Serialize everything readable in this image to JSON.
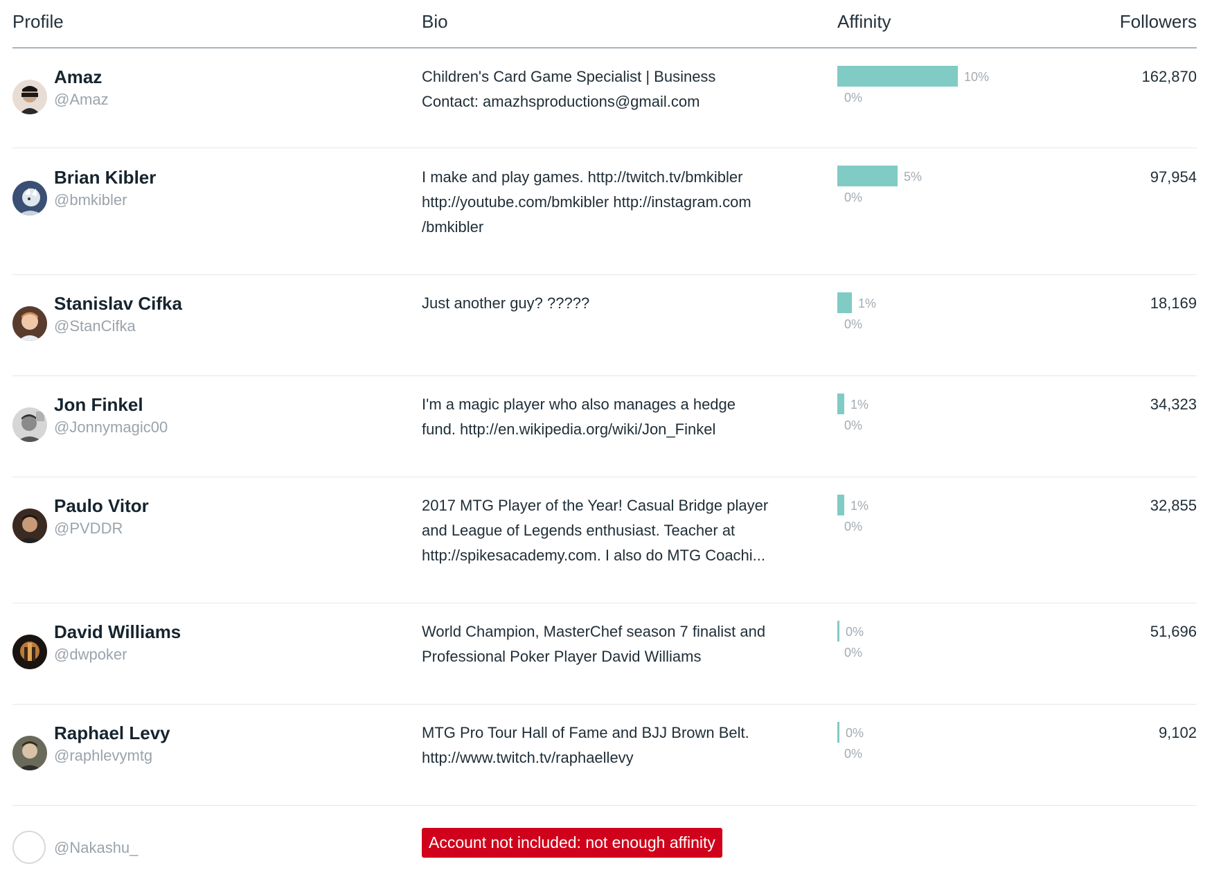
{
  "header": {
    "profile": "Profile",
    "bio": "Bio",
    "affinity": "Affinity",
    "followers": "Followers"
  },
  "rows": [
    {
      "name": "Amaz",
      "handle": "@Amaz",
      "bio": [
        "Children's Card Game Specialist | Business",
        "Contact: amazhsproductions@gmail.com"
      ],
      "affinity": 10,
      "affinity_label": "10%",
      "baseline_label": "0%",
      "followers": "162,870"
    },
    {
      "name": "Brian Kibler",
      "handle": "@bmkibler",
      "bio": [
        "I make and play games. http://twitch.tv/bmkibler",
        "http://youtube.com/bmkibler http://instagram.com",
        "/bmkibler"
      ],
      "affinity": 5,
      "affinity_label": "5%",
      "baseline_label": "0%",
      "followers": "97,954"
    },
    {
      "name": "Stanislav Cifka",
      "handle": "@StanCifka",
      "bio": [
        "Just another guy? ?????"
      ],
      "affinity": 1.2,
      "affinity_label": "1%",
      "baseline_label": "0%",
      "followers": "18,169"
    },
    {
      "name": "Jon Finkel",
      "handle": "@Jonnymagic00",
      "bio": [
        "I'm a magic player who also manages a hedge",
        "fund. http://en.wikipedia.org/wiki/Jon_Finkel"
      ],
      "affinity": 0.6,
      "affinity_label": "1%",
      "baseline_label": "0%",
      "followers": "34,323"
    },
    {
      "name": "Paulo Vitor",
      "handle": "@PVDDR",
      "bio": [
        "2017 MTG Player of the Year! Casual Bridge player",
        "and League of Legends enthusiast. Teacher at",
        "http://spikesacademy.com. I also do MTG Coachi..."
      ],
      "affinity": 0.55,
      "affinity_label": "1%",
      "baseline_label": "0%",
      "followers": "32,855"
    },
    {
      "name": "David Williams",
      "handle": "@dwpoker",
      "bio": [
        "World Champion, MasterChef season 7 finalist and",
        "Professional Poker Player David Williams"
      ],
      "affinity": 0.15,
      "affinity_label": "0%",
      "baseline_label": "0%",
      "followers": "51,696"
    },
    {
      "name": "Raphael Levy",
      "handle": "@raphlevymtg",
      "bio": [
        "MTG Pro Tour Hall of Fame and BJJ Brown Belt.",
        "http://www.twitch.tv/raphaellevy"
      ],
      "affinity": 0.15,
      "affinity_label": "0%",
      "baseline_label": "0%",
      "followers": "9,102"
    }
  ],
  "excluded": {
    "handle": "@Nakashu_",
    "message": "Account not included: not enough affinity"
  },
  "colors": {
    "bar": "#80cbc4",
    "badge": "#d0021b"
  },
  "icons": [
    "avatar-icon"
  ]
}
